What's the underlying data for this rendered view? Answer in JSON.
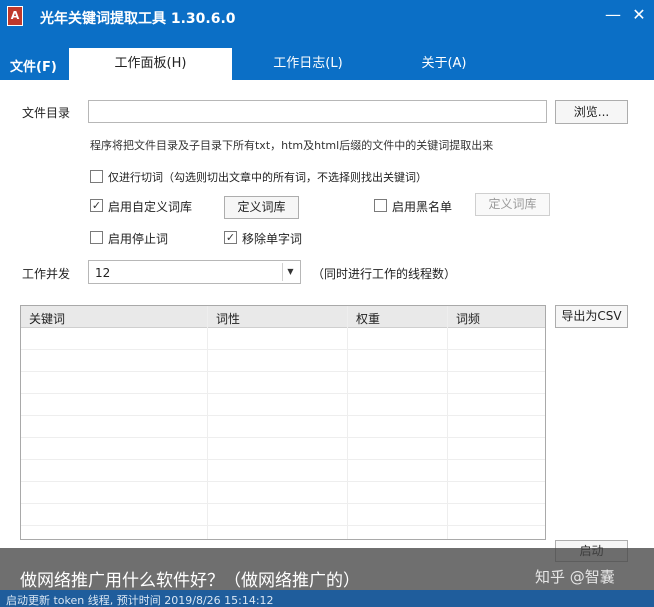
{
  "window": {
    "title": "光年关键词提取工具 1.30.6.0",
    "icon_letter": "A",
    "minimize": "—",
    "close": "✕"
  },
  "menu": {
    "file": "文件(F)",
    "tabs": [
      {
        "label": "工作面板(H)",
        "active": true
      },
      {
        "label": "工作日志(L)",
        "active": false
      },
      {
        "label": "关于(A)",
        "active": false
      }
    ]
  },
  "form": {
    "dir_label": "文件目录",
    "dir_value": "",
    "browse_label": "浏览...",
    "description": "程序将把文件目录及子目录下所有txt，htm及html后缀的文件中的关键词提取出来",
    "opt_segment_only": {
      "label": "仅进行切词（勾选则切出文章中的所有词，不选择则找出关键词）",
      "checked": false
    },
    "opt_custom_dict": {
      "label": "启用自定义词库",
      "checked": true
    },
    "define_dict_label": "定义词库",
    "opt_blacklist": {
      "label": "启用黑名单",
      "checked": false
    },
    "define_blacklist_label": "定义词库",
    "opt_stopwords": {
      "label": "启用停止词",
      "checked": false
    },
    "opt_remove_single": {
      "label": "移除单字词",
      "checked": true
    },
    "concurrency_label": "工作并发",
    "concurrency_value": "12",
    "concurrency_hint": "（同时进行工作的线程数）"
  },
  "table": {
    "columns": [
      "关键词",
      "词性",
      "权重",
      "词频"
    ],
    "rows": []
  },
  "actions": {
    "export_csv": "导出为CSV",
    "start": "启动"
  },
  "banner": {
    "text": "做网络推广用什么软件好？（做网络推广的）",
    "watermark": "知乎 @智囊"
  },
  "status": {
    "text": "启动更新 token 线程, 预计时间 2019/8/26 15:14:12"
  }
}
